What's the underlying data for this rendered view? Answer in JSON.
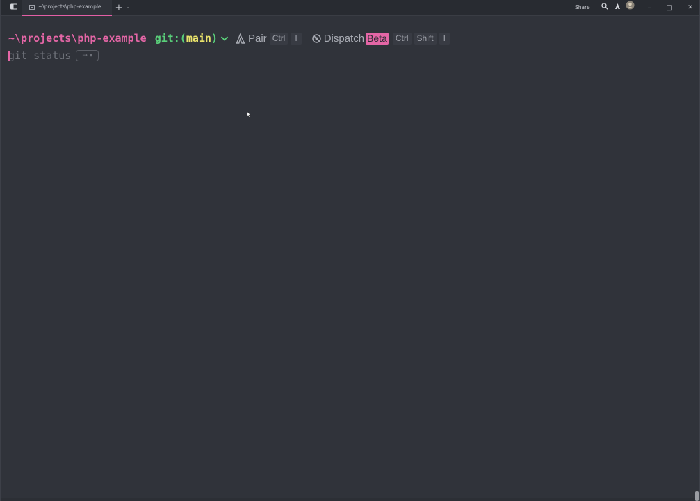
{
  "window": {
    "tab_title": "~\\projects\\php-example",
    "share_label": "Share",
    "new_tab_glyph": "+",
    "tab_menu_glyph": "⌄",
    "minimize_glyph": "–",
    "maximize_glyph": "□",
    "close_glyph": "✕"
  },
  "prompt": {
    "path": "~\\projects\\php-example",
    "git_prefix": "git:(",
    "branch": "main",
    "git_suffix": ")",
    "pair": {
      "label": "Pair",
      "keys": [
        "Ctrl",
        "I"
      ]
    },
    "dispatch": {
      "label": "Dispatch",
      "badge": "Beta",
      "keys": [
        "Ctrl",
        "Shift",
        "I"
      ]
    }
  },
  "input": {
    "suggestion": "git status",
    "accept_glyph": "→ ▾"
  },
  "colors": {
    "background": "#30333a",
    "accent": "#e466a6",
    "git_green": "#5ad07a",
    "branch_yellow": "#e9e36b"
  },
  "icons": {
    "sidebar": "panel-icon",
    "search": "search-icon",
    "warp_ai": "ai-icon",
    "avatar": "avatar-icon"
  }
}
